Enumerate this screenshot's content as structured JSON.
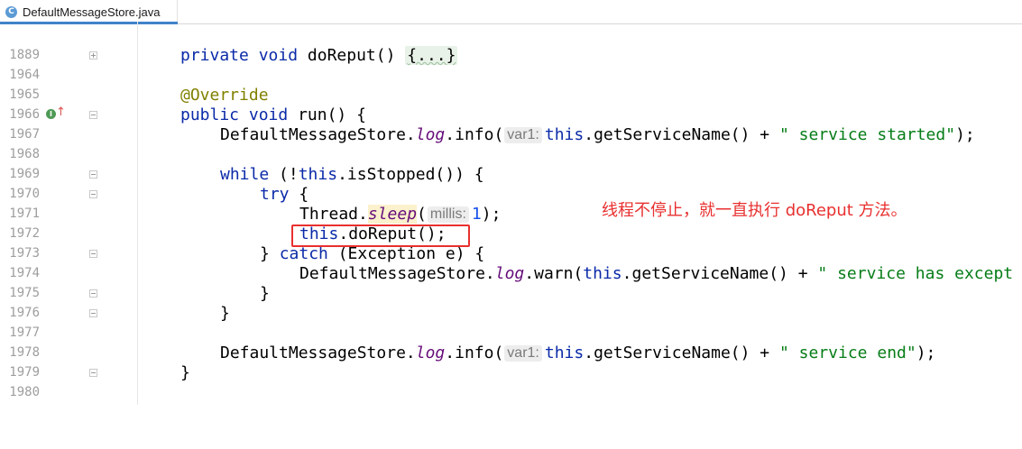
{
  "tab": {
    "icon_letter": "C",
    "file_name": "DefaultMessageStore.java"
  },
  "lines": [
    {
      "n": "1889",
      "code": [
        "private",
        " ",
        "void",
        " doReput() ",
        "{...}"
      ]
    },
    {
      "n": "1964"
    },
    {
      "n": "1965",
      "code": [
        "@Override"
      ]
    },
    {
      "n": "1966",
      "code": [
        "public",
        " ",
        "void",
        " run() {"
      ]
    },
    {
      "n": "1967",
      "code": [
        "DefaultMessageStore.",
        "log",
        ".info(",
        "var1:",
        "this",
        ".getServiceName() + ",
        "\" service started\"",
        ");"
      ]
    },
    {
      "n": "1968"
    },
    {
      "n": "1969",
      "code": [
        "while",
        " (!",
        "this",
        ".isStopped()) {"
      ]
    },
    {
      "n": "1970",
      "code": [
        "try",
        " {"
      ]
    },
    {
      "n": "1971",
      "code": [
        "Thread.",
        "sleep",
        "(",
        "millis:",
        "1",
        ");"
      ]
    },
    {
      "n": "1972",
      "code": [
        "this",
        ".doReput();"
      ]
    },
    {
      "n": "1973",
      "code": [
        "} ",
        "catch",
        " (Exception e) {"
      ]
    },
    {
      "n": "1974",
      "code": [
        "DefaultMessageStore.",
        "log",
        ".warn(",
        "this",
        ".getServiceName() + ",
        "\" service has except"
      ]
    },
    {
      "n": "1975",
      "code": [
        "}"
      ]
    },
    {
      "n": "1976",
      "code": [
        "}"
      ]
    },
    {
      "n": "1977"
    },
    {
      "n": "1978",
      "code": [
        "DefaultMessageStore.",
        "log",
        ".info(",
        "var1:",
        "this",
        ".getServiceName() + ",
        "\" service end\"",
        ");"
      ]
    },
    {
      "n": "1979",
      "code": [
        "}"
      ]
    },
    {
      "n": "1980"
    }
  ],
  "annotation": {
    "text": "线程不停止，就一直执行 doReput 方法。",
    "color": "#e8302f"
  },
  "colors": {
    "keyword": "#0a2aa8",
    "annotation_keyword": "#808000",
    "static_field": "#660e7a",
    "string": "#067d17",
    "number": "#1750eb"
  }
}
